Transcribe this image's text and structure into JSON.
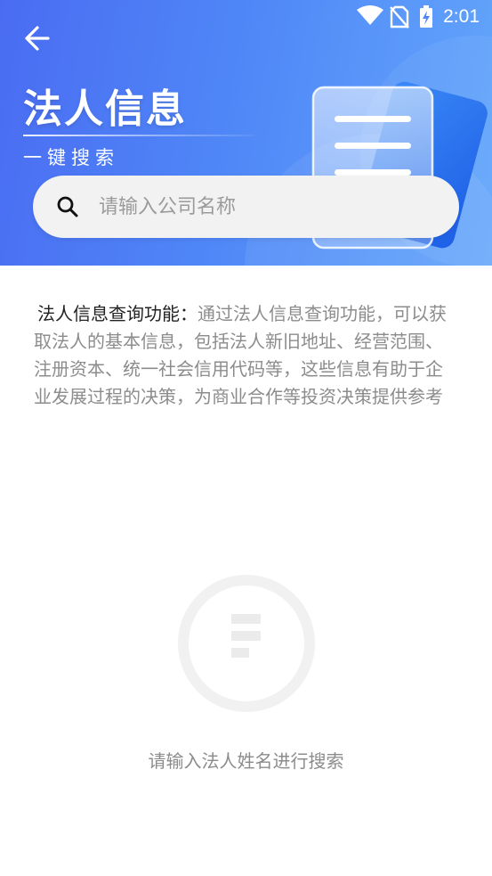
{
  "status_bar": {
    "time": "2:01",
    "icons": [
      "wifi-icon",
      "no-sim-icon",
      "battery-charging-icon"
    ]
  },
  "header": {
    "back_icon": "arrow-left-icon",
    "title": "法人信息",
    "subtitle": "一键搜索",
    "illustration_icon": "document-icon"
  },
  "search": {
    "icon": "search-icon",
    "placeholder": "请输入公司名称",
    "value": ""
  },
  "description": {
    "label": "法人信息查询功能：",
    "text": "通过法人信息查询功能，可以获取法人的基本信息，包括法人新旧地址、经营范围、注册资本、统一社会信用代码等，这些信息有助于企业发展过程的决策，为商业合作等投资决策提供参考"
  },
  "empty_state": {
    "icon": "empty-document-icon",
    "message": "请输入法人姓名进行搜索"
  },
  "colors": {
    "header_gradient_start": "#4a6cf2",
    "header_gradient_end": "#63a6fb",
    "search_background": "#f2f2f2",
    "text_primary": "#222222",
    "text_secondary": "#8c8c8c"
  }
}
